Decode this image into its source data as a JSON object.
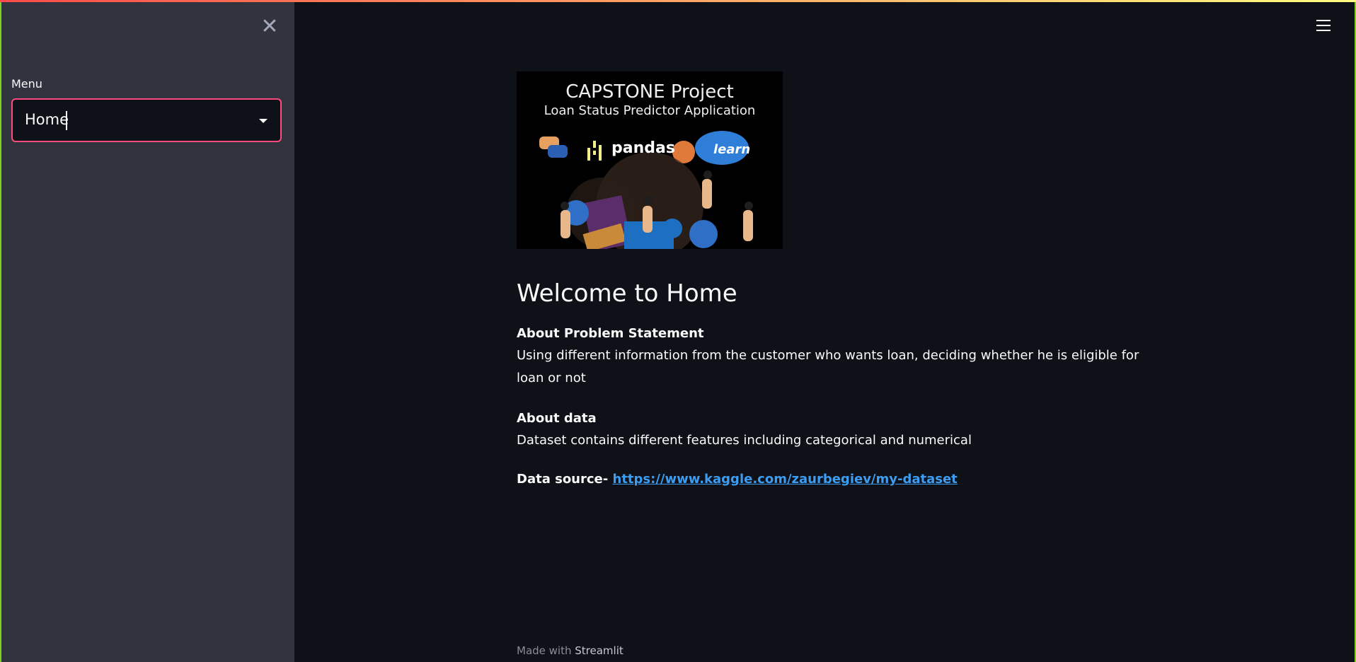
{
  "sidebar": {
    "menu_label": "Menu",
    "select_value": "Home"
  },
  "banner": {
    "title": "CAPSTONE Project",
    "subtitle": "Loan Status Predictor Application",
    "logo_pandas": "pandas",
    "logo_learn": "learn"
  },
  "main": {
    "heading": "Welcome to Home",
    "problem_title": "About Problem Statement",
    "problem_text": "Using different information from the customer who wants loan, deciding whether he is eligible for loan or not",
    "data_title": "About data",
    "data_text": "Dataset contains different features including categorical and numerical",
    "source_label": "Data source-",
    "source_link": "https://www.kaggle.com/zaurbegiev/my-dataset"
  },
  "footer": {
    "made_with": "Made with",
    "brand": "Streamlit"
  },
  "colors": {
    "accent": "#ff4b80",
    "link": "#3d9df3",
    "sidebar_bg": "#31333f",
    "main_bg": "#0e1117"
  },
  "icons": {
    "close": "close-icon",
    "menu": "hamburger-icon",
    "dropdown": "chevron-down-icon"
  }
}
